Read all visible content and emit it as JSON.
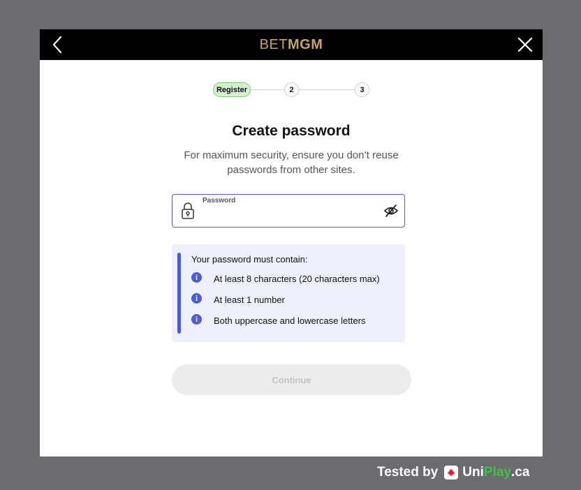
{
  "header": {
    "logo_light": "BET",
    "logo_bold": "MGM",
    "back_icon": "chevron-left-icon",
    "close_icon": "close-icon"
  },
  "stepper": {
    "steps": [
      {
        "label": "Register",
        "state": "active"
      },
      {
        "label": "2",
        "state": "pending"
      },
      {
        "label": "3",
        "state": "pending"
      }
    ]
  },
  "main": {
    "title": "Create password",
    "subtitle": "For maximum security, ensure you don’t reuse passwords from other sites."
  },
  "password_field": {
    "label": "Password",
    "value": "",
    "lock_icon": "lock-icon",
    "visibility_icon": "eye-slash-icon"
  },
  "rules": {
    "heading": "Your password must contain:",
    "items": [
      "At least 8 characters (20 characters max)",
      "At least 1 number",
      "Both uppercase and lowercase letters"
    ],
    "icon": "info-icon"
  },
  "actions": {
    "continue_label": "Continue",
    "continue_enabled": false
  },
  "watermark": {
    "tested_by": "Tested by",
    "brand_uni": "Uni",
    "brand_play": "Play",
    "brand_ca": ".ca"
  },
  "colors": {
    "accent": "#4d5bd6",
    "logo_gold": "#c9a45a",
    "step_active_bg": "#d7f0d0",
    "rules_bg": "#eef0fc",
    "overlay": "#6a6c70"
  }
}
